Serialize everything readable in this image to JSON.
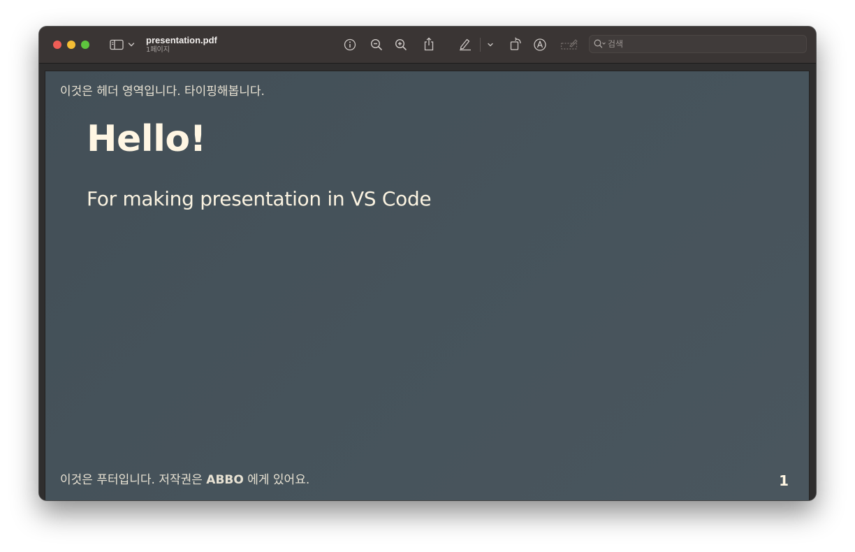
{
  "window": {
    "title": "presentation.pdf",
    "subtitle": "1페이지"
  },
  "toolbar": {
    "icons": [
      "sidebar-icon",
      "chevron-down-icon",
      "info-icon",
      "zoom-out-icon",
      "zoom-in-icon",
      "share-icon",
      "highlight-pen-icon",
      "chevron-down-icon",
      "rotate-icon",
      "markup-icon",
      "signature-icon",
      "search-icon"
    ]
  },
  "search": {
    "placeholder": "검색",
    "value": ""
  },
  "page": {
    "header": "이것은 헤더 영역입니다. 타이핑해봅니다.",
    "heading": "Hello!",
    "subheading": "For making presentation in VS Code",
    "footer_prefix": "이것은 푸터입니다. 저작권은 ",
    "footer_strong": "ABBO",
    "footer_suffix": " 에게 있어요.",
    "page_number": "1"
  },
  "colors": {
    "slide_background": "#46535b",
    "slide_text": "#fff6e3",
    "titlebar": "#3a3534",
    "close": "#ee5d56",
    "minimize": "#f4bd34",
    "maximize": "#5ec43e"
  }
}
